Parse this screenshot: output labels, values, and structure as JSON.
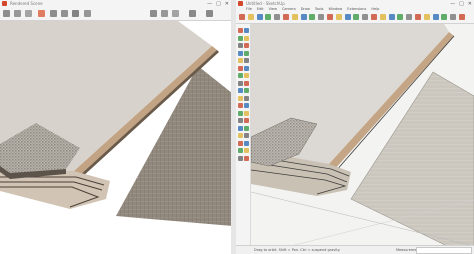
{
  "left_window": {
    "title": "Rendered Scene",
    "controls": [
      "—",
      "□",
      "✕"
    ],
    "toolbar_icons": [
      "save-icon",
      "copy-icon",
      "folder-icon",
      "render-icon",
      "image-icon",
      "region-icon",
      "layers-icon",
      "compare-icon",
      "settings-icon",
      "channels-icon",
      "export-icon",
      "undo-icon",
      "redo-icon"
    ]
  },
  "right_window": {
    "title": "Untitled - SketchUp",
    "controls": [
      "—",
      "□",
      "✕"
    ],
    "menu": [
      "File",
      "Edit",
      "View",
      "Camera",
      "Draw",
      "Tools",
      "Window",
      "Extensions",
      "Help"
    ],
    "status_text": "Drag to orbit. Shift = Pan. Ctrl = suspend gravity.",
    "measurements_label": "Measurements"
  },
  "colors": {
    "sketchup_red": "#c9472d",
    "sketchup_blue": "#2f6fb5",
    "sketchup_green": "#3a9a48",
    "sketchup_yellow": "#e0b43a",
    "board_edge": "#c4a88a",
    "board_top": "#d9d3cc",
    "carpet": "#8f8578",
    "carpet_right": "#c9c5bc"
  }
}
